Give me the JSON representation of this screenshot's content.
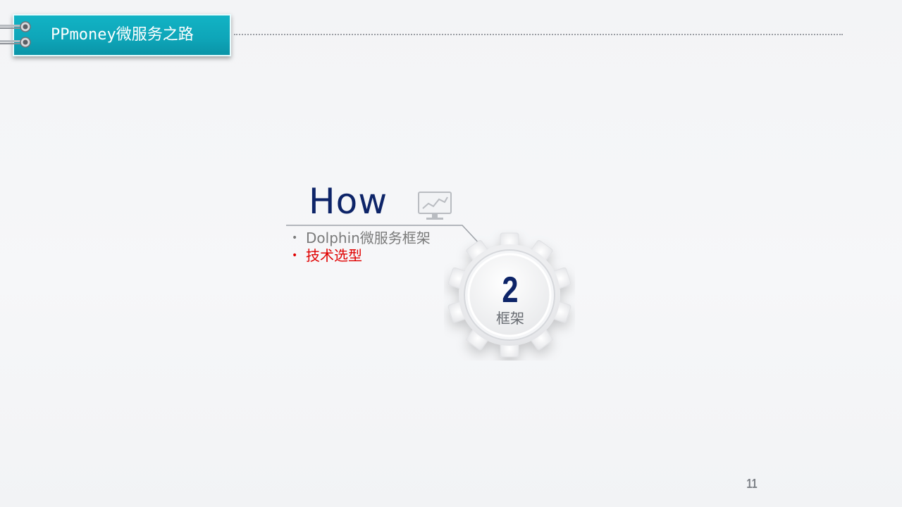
{
  "header": {
    "title": "PPmoney微服务之路",
    "accent_color": "#0ea5b8"
  },
  "content": {
    "heading": "How",
    "heading_color": "#0d2468",
    "icon": "chart-monitor-icon",
    "items": [
      {
        "label": "Dolphin微服务框架",
        "color": "#7a7a7a",
        "active": false
      },
      {
        "label": "技术选型",
        "color": "#e00000",
        "active": true
      }
    ]
  },
  "gear": {
    "number": "2",
    "label": "框架",
    "icon": "gear-icon"
  },
  "footer": {
    "page_number": "11"
  }
}
